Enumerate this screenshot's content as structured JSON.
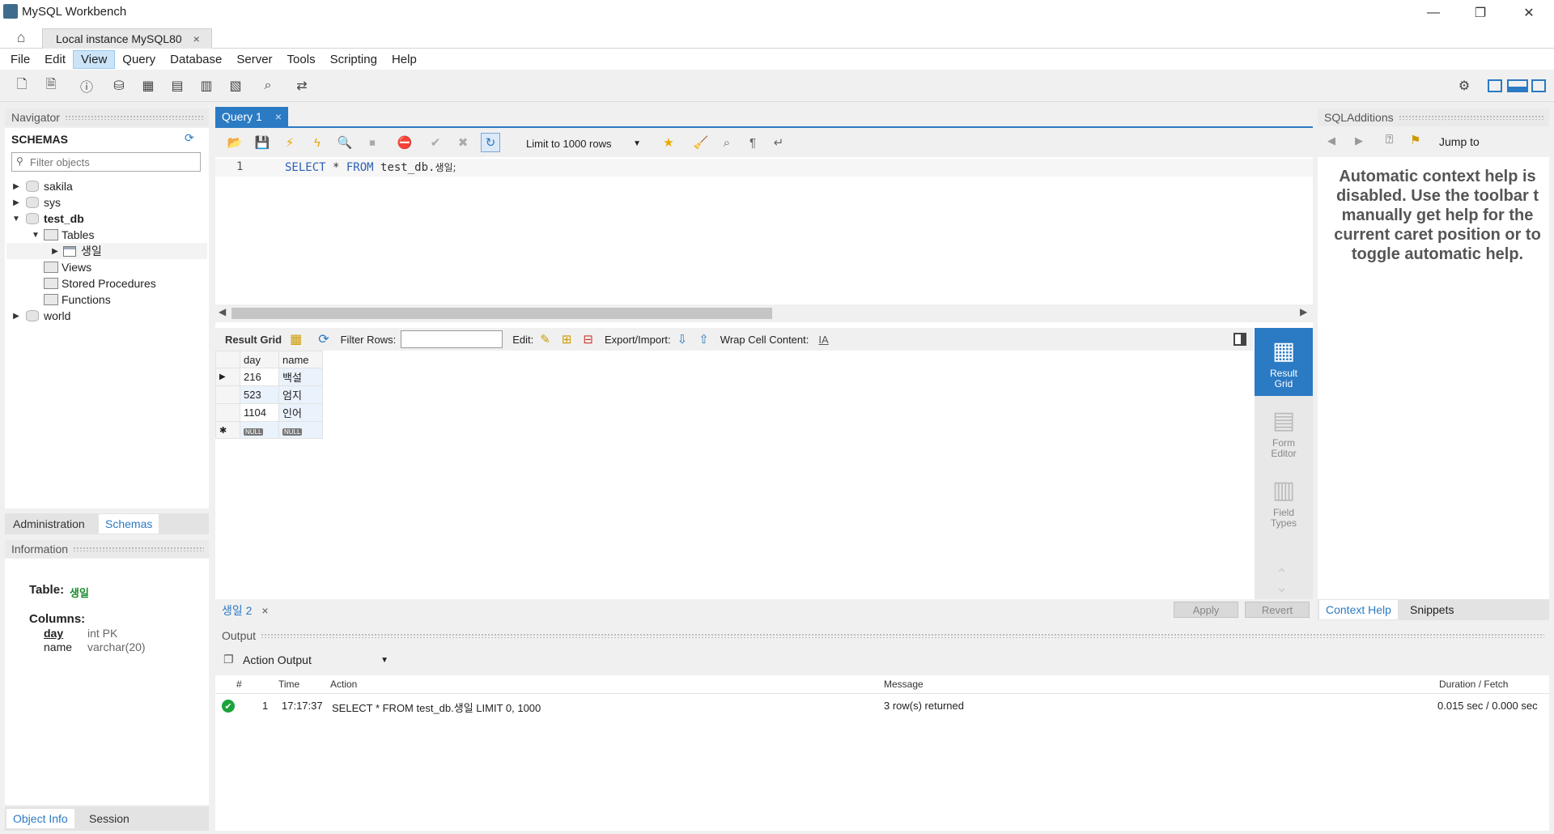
{
  "window": {
    "title": "MySQL Workbench",
    "minimize": "—",
    "maximize": "❐",
    "close": "✕"
  },
  "connection_tab": {
    "label": "Local instance MySQL80",
    "close": "×"
  },
  "menu": [
    "File",
    "Edit",
    "View",
    "Query",
    "Database",
    "Server",
    "Tools",
    "Scripting",
    "Help"
  ],
  "navigator": {
    "header": "Navigator",
    "schemas_title": "SCHEMAS",
    "filter_placeholder": "Filter objects",
    "tree": {
      "sakila": "sakila",
      "sys": "sys",
      "test_db": "test_db",
      "tables": "Tables",
      "table_name": "생일",
      "views": "Views",
      "stored_procedures": "Stored Procedures",
      "functions": "Functions",
      "world": "world"
    },
    "tabs": {
      "administration": "Administration",
      "schemas": "Schemas"
    }
  },
  "information": {
    "header": "Information",
    "table_label": "Table:",
    "table_name": "생일",
    "columns_label": "Columns:",
    "columns": [
      {
        "name": "day",
        "type": "int PK"
      },
      {
        "name": "name",
        "type": "varchar(20)"
      }
    ],
    "tabs": {
      "object_info": "Object Info",
      "session": "Session"
    }
  },
  "query": {
    "tab_label": "Query 1",
    "tab_close": "×",
    "limit": "Limit to 1000 rows",
    "line_number": "1",
    "sql_kw1": "SELECT",
    "sql_mid": " * ",
    "sql_kw2": "FROM",
    "sql_rest": " test_db.",
    "sql_table": "생일;"
  },
  "result": {
    "toolbar": {
      "result_grid": "Result Grid",
      "filter_rows": "Filter Rows:",
      "edit": "Edit:",
      "export_import": "Export/Import:",
      "wrap": "Wrap Cell Content:"
    },
    "columns": [
      "day",
      "name"
    ],
    "rows": [
      {
        "day": "216",
        "name": "백설"
      },
      {
        "day": "523",
        "name": "엄지"
      },
      {
        "day": "1104",
        "name": "인어"
      }
    ],
    "null_label": "NULL",
    "side": {
      "result_grid": "Result Grid",
      "form_editor": "Form Editor",
      "field_types": "Field Types"
    },
    "tab_label": "생일 2",
    "tab_close": "×",
    "apply": "Apply",
    "revert": "Revert"
  },
  "output": {
    "header": "Output",
    "selector": "Action Output",
    "columns": {
      "num": "#",
      "time": "Time",
      "action": "Action",
      "message": "Message",
      "duration": "Duration / Fetch"
    },
    "rows": [
      {
        "num": "1",
        "time": "17:17:37",
        "action": "SELECT * FROM test_db.생일 LIMIT 0, 1000",
        "message": "3 row(s) returned",
        "duration": "0.015 sec / 0.000 sec"
      }
    ]
  },
  "sql_additions": {
    "header": "SQLAdditions",
    "jump_to": "Jump to",
    "help_lines": [
      "Automatic context help is",
      "disabled. Use the toolbar t",
      "manually get help for the",
      "current caret position or to",
      "toggle automatic help."
    ],
    "tabs": {
      "context_help": "Context Help",
      "snippets": "Snippets"
    }
  },
  "colors": {
    "accent": "#2b7ac4",
    "keyword": "#2b61b4",
    "success": "#1aa33b"
  }
}
